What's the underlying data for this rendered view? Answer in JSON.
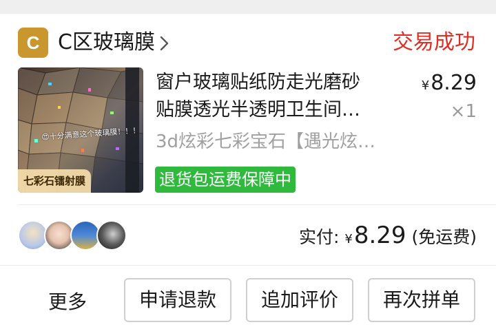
{
  "store": {
    "logo_letter": "C",
    "name": "C区玻璃膜",
    "order_status": "交易成功"
  },
  "product": {
    "title_line1": "窗户玻璃贴纸防走光磨砂",
    "title_line2": "贴膜透光半透明卫生间…",
    "sku": "3d炫彩七彩宝石【遇光炫…",
    "price_symbol": "¥",
    "price": "8.29",
    "quantity": "×1",
    "badge": "退货包运费保障中",
    "image_caption": "七彩石镭射膜",
    "image_overlay_text": "😍十分满意这个玻璃膜！！！"
  },
  "payment": {
    "label": "实付:",
    "symbol": "¥",
    "amount": "8.29",
    "note": "(免运费)"
  },
  "actions": {
    "more": "更多",
    "refund": "申请退款",
    "add_review": "追加评价",
    "reorder": "再次拼单"
  },
  "colors": {
    "status_red": "#e02e24",
    "badge_green": "#2fba3e",
    "logo_gold": "#c9972e"
  },
  "icons": [
    "chevron-right-icon"
  ]
}
